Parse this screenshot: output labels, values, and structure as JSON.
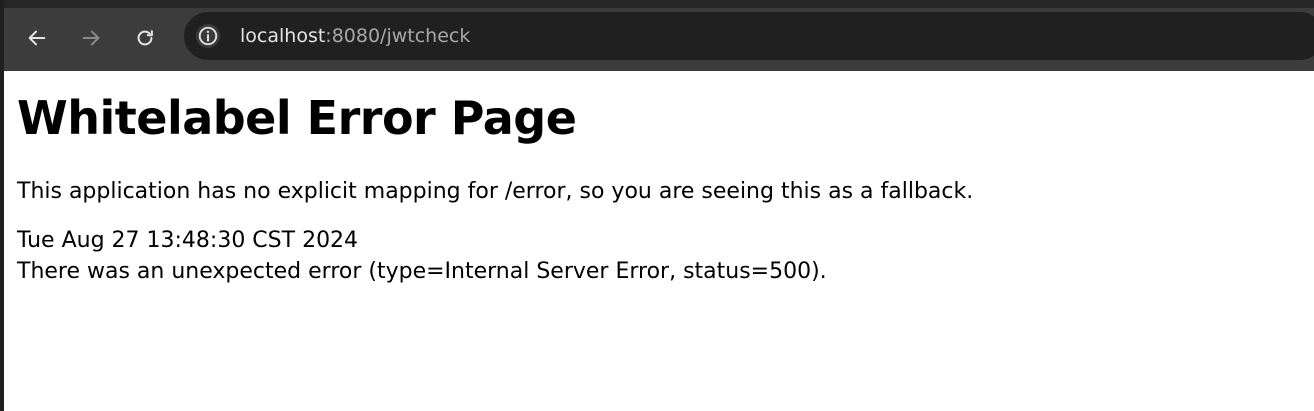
{
  "browser": {
    "url": {
      "host": "localhost",
      "path": ":8080/jwtcheck"
    },
    "icons": {
      "back": "arrow-left-icon",
      "forward": "arrow-right-icon",
      "reload": "reload-icon",
      "site_info": "info-icon"
    },
    "colors": {
      "toolbar": "#3c3c3c",
      "omnibox": "#202020",
      "url_text": "#e3e3e3"
    }
  },
  "page": {
    "title": "Whitelabel Error Page",
    "message": "This application has no explicit mapping for /error, so you are seeing this as a fallback.",
    "timestamp": "Tue Aug 27 13:48:30 CST 2024",
    "error_detail": "There was an unexpected error (type=Internal Server Error, status=500)."
  }
}
